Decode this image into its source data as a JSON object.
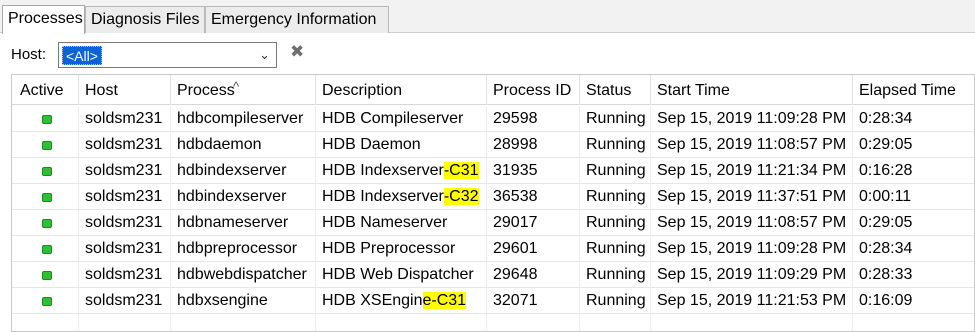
{
  "tabs": [
    {
      "label": "Processes",
      "active": true
    },
    {
      "label": "Diagnosis Files",
      "active": false
    },
    {
      "label": "Emergency Information",
      "active": false
    }
  ],
  "host_filter": {
    "label": "Host:",
    "selected": "<All>",
    "clear_icon": "close-x-icon"
  },
  "table": {
    "columns": [
      "Active",
      "Host",
      "Process",
      "Description",
      "Process ID",
      "Status",
      "Start Time",
      "Elapsed Time"
    ],
    "sorted_column": "Process",
    "rows": [
      {
        "host": "soldsm231",
        "process": "hdbcompileserver",
        "desc_main": "HDB Compileserver",
        "desc_hl": "",
        "pid": "29598",
        "status": "Running",
        "start": "Sep 15, 2019 11:09:28 PM",
        "elapsed": "0:28:34"
      },
      {
        "host": "soldsm231",
        "process": "hdbdaemon",
        "desc_main": "HDB Daemon",
        "desc_hl": "",
        "pid": "28998",
        "status": "Running",
        "start": "Sep 15, 2019 11:08:57 PM",
        "elapsed": "0:29:05"
      },
      {
        "host": "soldsm231",
        "process": "hdbindexserver",
        "desc_main": "HDB Indexserver",
        "desc_hl": "-C31",
        "pid": "31935",
        "status": "Running",
        "start": "Sep 15, 2019 11:21:34 PM",
        "elapsed": "0:16:28"
      },
      {
        "host": "soldsm231",
        "process": "hdbindexserver",
        "desc_main": "HDB Indexserver",
        "desc_hl": "-C32",
        "pid": "36538",
        "status": "Running",
        "start": "Sep 15, 2019 11:37:51 PM",
        "elapsed": "0:00:11"
      },
      {
        "host": "soldsm231",
        "process": "hdbnameserver",
        "desc_main": "HDB Nameserver",
        "desc_hl": "",
        "pid": "29017",
        "status": "Running",
        "start": "Sep 15, 2019 11:08:57 PM",
        "elapsed": "0:29:05"
      },
      {
        "host": "soldsm231",
        "process": "hdbpreprocessor",
        "desc_main": "HDB Preprocessor",
        "desc_hl": "",
        "pid": "29601",
        "status": "Running",
        "start": "Sep 15, 2019 11:09:28 PM",
        "elapsed": "0:28:34"
      },
      {
        "host": "soldsm231",
        "process": "hdbwebdispatcher",
        "desc_main": "HDB Web Dispatcher",
        "desc_hl": "",
        "pid": "29648",
        "status": "Running",
        "start": "Sep 15, 2019 11:09:29 PM",
        "elapsed": "0:28:33"
      },
      {
        "host": "soldsm231",
        "process": "hdbxsengine",
        "desc_main": "HDB XSEngin",
        "desc_hl": "e-C31",
        "pid": "32071",
        "status": "Running",
        "start": "Sep 15, 2019 11:21:53 PM",
        "elapsed": "0:16:09"
      }
    ]
  },
  "colors": {
    "active_indicator": "#2fbf36",
    "highlight": "#ffff00",
    "selection": "#0a64d6"
  }
}
